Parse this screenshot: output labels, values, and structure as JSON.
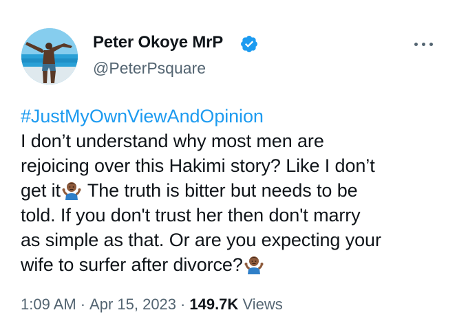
{
  "author": {
    "display_name": "Peter Okoye MrP",
    "handle": "@PeterPsquare",
    "verified": true,
    "verified_color": "#1d9bf0"
  },
  "tweet": {
    "hashtag": "#JustMyOwnViewAndOpinion",
    "line_1": "I don’t understand why most men are",
    "line_2": "rejoicing over this Hakimi story? Like I don’t",
    "line_3a": "get it",
    "line_3b": " The truth is bitter but needs to be",
    "line_4": "told. If you don't trust her then don't marry",
    "line_5": "as simple as that. Or are you expecting your",
    "line_6": "wife to surfer after divorce?",
    "emoji_name": "person-shrugging-emoji"
  },
  "meta": {
    "time": "1:09 AM",
    "separator": "·",
    "date": "Apr 15, 2023",
    "views_count": "149.7K",
    "views_label": "Views"
  },
  "icons": {
    "more": "more-options-icon",
    "verified": "verified-badge-icon"
  },
  "colors": {
    "link": "#1d9bf0",
    "text": "#0f1419",
    "secondary": "#536471"
  }
}
